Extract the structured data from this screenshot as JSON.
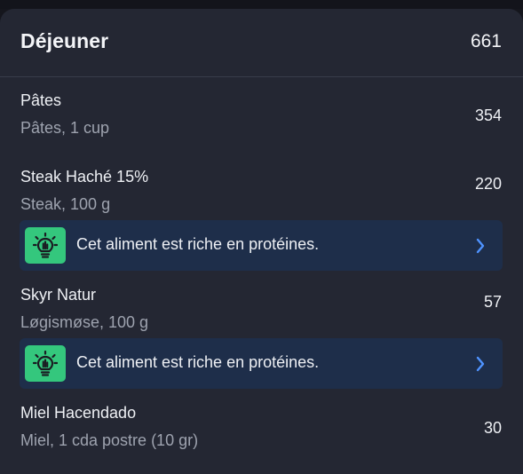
{
  "meal": {
    "title": "Déjeuner",
    "total_calories": "661"
  },
  "items": [
    {
      "name": "Pâtes",
      "detail": "Pâtes, 1 cup",
      "calories": "354"
    },
    {
      "name": "Steak Haché 15%",
      "detail": "Steak, 100 g",
      "calories": "220",
      "tip": {
        "text": "Cet aliment est riche en protéines.",
        "icon": "lightbulb-icon"
      }
    },
    {
      "name": "Skyr Natur",
      "detail": "Løgismøse, 100 g",
      "calories": "57",
      "tip": {
        "text": "Cet aliment est riche en protéines.",
        "icon": "lightbulb-icon"
      }
    },
    {
      "name": "Miel Hacendado",
      "detail": "Miel, 1 cda postre (10 gr)",
      "calories": "30"
    }
  ],
  "colors": {
    "background": "#15161d",
    "card": "#242733",
    "tip_background": "#1e2e4a",
    "tip_icon_green": "#34c77d",
    "chevron_blue": "#4f93ff",
    "secondary_text": "#9ea3af"
  }
}
